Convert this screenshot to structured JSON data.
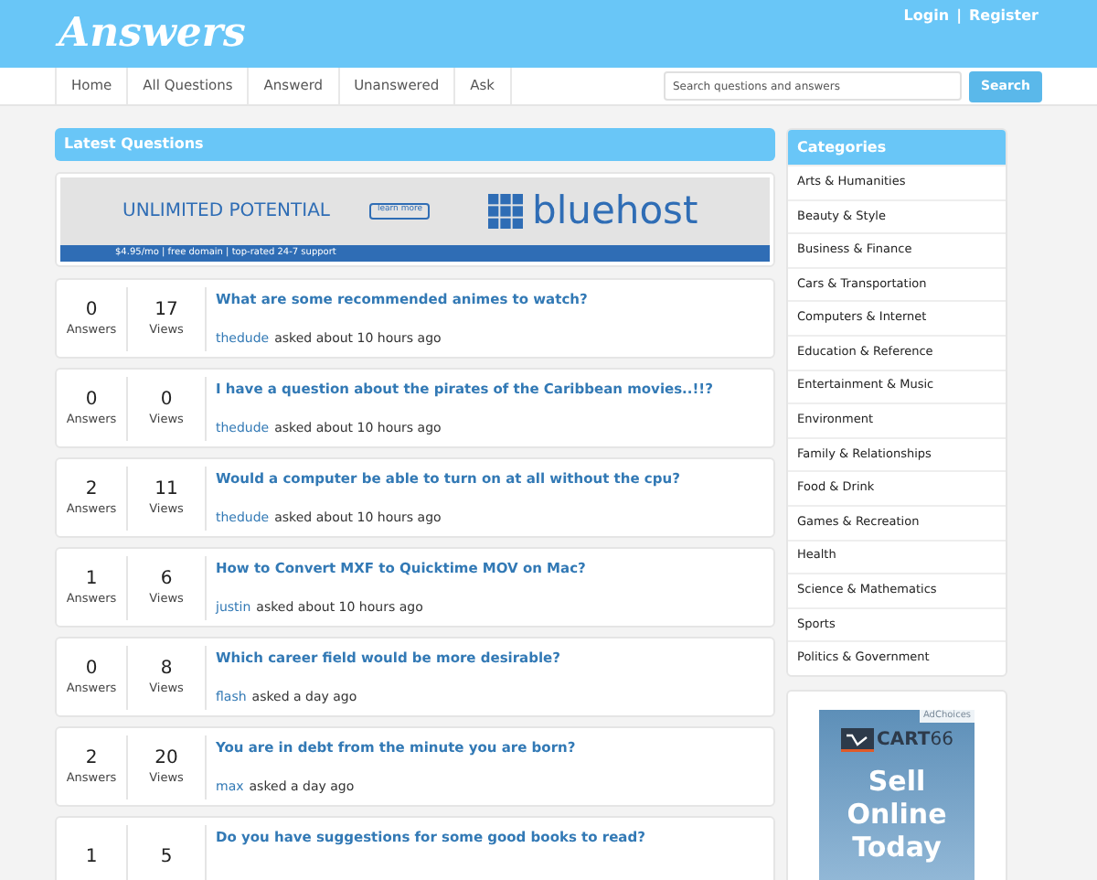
{
  "header": {
    "logo": "Answers",
    "links": [
      "Login",
      "Register"
    ],
    "separator": "|"
  },
  "nav": {
    "items": [
      {
        "label": "Home",
        "selected": false
      },
      {
        "label": "All Questions",
        "selected": false
      },
      {
        "label": "Answerd",
        "selected": false
      },
      {
        "label": "Unanswered",
        "selected": false
      },
      {
        "label": "Ask",
        "selected": false
      }
    ],
    "search": {
      "placeholder": "Search questions and answers",
      "button": "Search"
    }
  },
  "latest": {
    "title": "Latest Questions",
    "ad": {
      "headline": "UNLIMITED POTENTIAL",
      "button": "learn more",
      "brand": "bluehost",
      "footer": "$4.95/mo | free domain | top-rated 24-7 support"
    },
    "questions": [
      {
        "answers": "0",
        "answers_label": "Answers",
        "views": "17",
        "views_label": "Views",
        "title": "What are some recommended animes to watch?",
        "user": "thedude",
        "meta": "asked about 10 hours ago"
      },
      {
        "answers": "0",
        "answers_label": "Answers",
        "views": "0",
        "views_label": "Views",
        "title": "I have a question about the pirates of the Caribbean movies..!!?",
        "user": "thedude",
        "meta": "asked about 10 hours ago"
      },
      {
        "answers": "2",
        "answers_label": "Answers",
        "views": "11",
        "views_label": "Views",
        "title": "Would a computer be able to turn on at all without the cpu?",
        "user": "thedude",
        "meta": "asked about 10 hours ago"
      },
      {
        "answers": "1",
        "answers_label": "Answers",
        "views": "6",
        "views_label": "Views",
        "title": "How to Convert MXF to Quicktime MOV on Mac?",
        "user": "justin",
        "meta": "asked about 10 hours ago"
      },
      {
        "answers": "0",
        "answers_label": "Answers",
        "views": "8",
        "views_label": "Views",
        "title": "Which career field would be more desirable?",
        "user": "flash",
        "meta": "asked a day ago"
      },
      {
        "answers": "2",
        "answers_label": "Answers",
        "views": "20",
        "views_label": "Views",
        "title": "You are in debt from the minute you are born?",
        "user": "max",
        "meta": "asked a day ago"
      },
      {
        "answers": "1",
        "views": "5",
        "title": "Do you have suggestions for some good books to read?"
      }
    ]
  },
  "categories": {
    "title": "Categories",
    "items": [
      "Arts & Humanities",
      "Beauty & Style",
      "Business & Finance",
      "Cars & Transportation",
      "Computers & Internet",
      "Education & Reference",
      "Entertainment & Music",
      "Environment",
      "Family & Relationships",
      "Food & Drink",
      "Games & Recreation",
      "Health",
      "Science & Mathematics",
      "Sports",
      "Politics & Government"
    ]
  },
  "side_ad": {
    "adchoices": "AdChoices",
    "brand": "CART",
    "brand_suffix": "66",
    "headline": "Sell Online Today"
  }
}
